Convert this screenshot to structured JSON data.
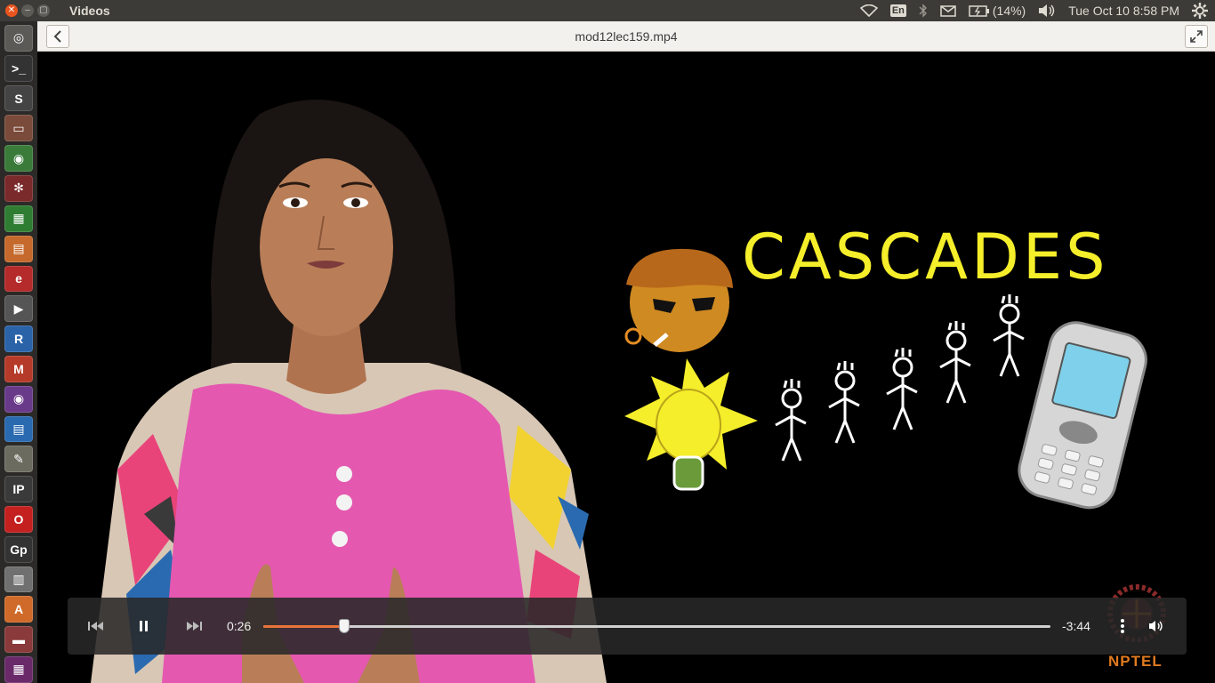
{
  "top_panel": {
    "app_title": "Videos",
    "keyboard_lang": "En",
    "battery": "(14%)",
    "datetime": "Tue Oct 10  8:58 PM"
  },
  "launcher": {
    "items": [
      {
        "name": "dash-home",
        "color": "#5b5a56",
        "glyph": "◎"
      },
      {
        "name": "terminal",
        "color": "#333333",
        "glyph": ">_"
      },
      {
        "name": "sublime-text",
        "color": "#444444",
        "glyph": "S"
      },
      {
        "name": "archive-manager",
        "color": "#7a4a3a",
        "glyph": "▭"
      },
      {
        "name": "chrome",
        "color": "#3a7b3a",
        "glyph": "◉"
      },
      {
        "name": "settings",
        "color": "#7a2a2a",
        "glyph": "✻"
      },
      {
        "name": "spreadsheet",
        "color": "#2f7d32",
        "glyph": "▦"
      },
      {
        "name": "presentation",
        "color": "#c56a2c",
        "glyph": "▤"
      },
      {
        "name": "document-viewer",
        "color": "#b52a2a",
        "glyph": "e"
      },
      {
        "name": "video-editor",
        "color": "#555555",
        "glyph": "▶"
      },
      {
        "name": "r-studio",
        "color": "#2a63a8",
        "glyph": "R"
      },
      {
        "name": "gmail",
        "color": "#b63a2a",
        "glyph": "M"
      },
      {
        "name": "media-player",
        "color": "#6a3a8a",
        "glyph": "◉"
      },
      {
        "name": "writer",
        "color": "#2a6ab0",
        "glyph": "▤"
      },
      {
        "name": "text-editor",
        "color": "#6b6b60",
        "glyph": "✎"
      },
      {
        "name": "ipython",
        "color": "#3a3a3a",
        "glyph": "IP"
      },
      {
        "name": "opera",
        "color": "#c42020",
        "glyph": "O"
      },
      {
        "name": "gnuplot",
        "color": "#333333",
        "glyph": "Gp"
      },
      {
        "name": "files",
        "color": "#707070",
        "glyph": "▥"
      },
      {
        "name": "software-center",
        "color": "#d06a2a",
        "glyph": "A"
      },
      {
        "name": "disks",
        "color": "#8a3a3a",
        "glyph": "▬"
      },
      {
        "name": "workspace",
        "color": "#6a2a6a",
        "glyph": "▦"
      }
    ]
  },
  "header": {
    "file_title": "mod12lec159.mp4"
  },
  "video": {
    "overlay_title": "CASCADES",
    "watermark": "NPTEL"
  },
  "controls": {
    "elapsed": "0:26",
    "remaining": "-3:44",
    "progress_fraction": 0.103,
    "accent_color": "#e8743a"
  }
}
